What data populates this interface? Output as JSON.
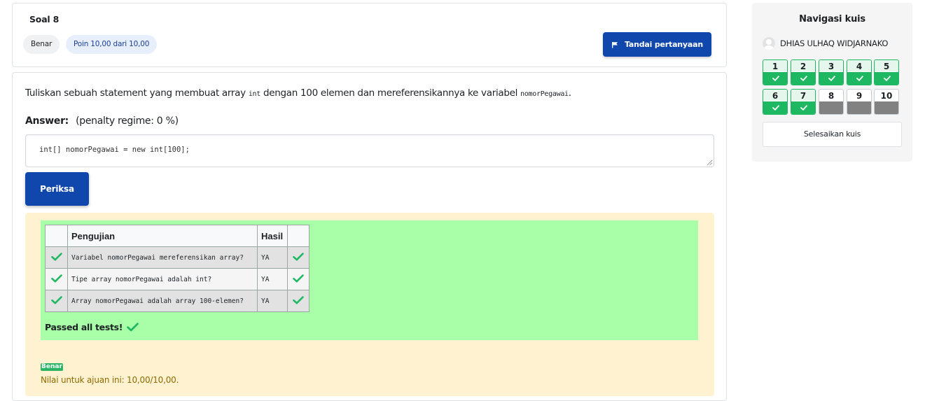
{
  "question": {
    "title": "Soal 8",
    "state": "Benar",
    "grade": "Poin 10,00 dari 10,00",
    "flag_label": "Tandai pertanyaan",
    "text_part1": "Tuliskan sebuah statement yang membuat array ",
    "code1": "int",
    "text_part2": " dengan 100 elemen dan mereferensikannya ke variabel ",
    "code2": "nomorPegawai",
    "text_part3": ".",
    "answer_label": "Answer:",
    "penalty": "(penalty regime: 0 %)",
    "answer_value": "int[] nomorPegawai = new int[100];",
    "check_label": "Periksa"
  },
  "results": {
    "headers": [
      "Pengujian",
      "Hasil"
    ],
    "rows": [
      {
        "test": "Variabel nomorPegawai mereferensikan array?",
        "result": "YA"
      },
      {
        "test": "Tipe array nomorPegawai adalah int?",
        "result": "YA"
      },
      {
        "test": "Array nomorPegawai adalah array 100-elemen?",
        "result": "YA"
      }
    ],
    "passed_text": "Passed all tests!",
    "correct_badge": "Benar",
    "mark_text": "Nilai untuk ajuan ini: 10,00/10,00."
  },
  "navigation": {
    "title": "Navigasi kuis",
    "user_name": "DHIAS ULHAQ WIDJARNAKO",
    "questions": [
      {
        "num": "1",
        "state": "answered"
      },
      {
        "num": "2",
        "state": "answered"
      },
      {
        "num": "3",
        "state": "answered"
      },
      {
        "num": "4",
        "state": "answered"
      },
      {
        "num": "5",
        "state": "answered"
      },
      {
        "num": "6",
        "state": "answered"
      },
      {
        "num": "7",
        "state": "answered"
      },
      {
        "num": "8",
        "state": "empty"
      },
      {
        "num": "9",
        "state": "empty"
      },
      {
        "num": "10",
        "state": "empty"
      }
    ],
    "finish_label": "Selesaikan kuis"
  },
  "colors": {
    "primary": "#0f47ad",
    "success": "#1fb862",
    "feedback_bg": "#fef2d1",
    "passed_bg": "#a8ffa8"
  },
  "icons": {
    "flag": "flag-icon",
    "check": "check-icon",
    "avatar": "user-avatar-icon"
  }
}
